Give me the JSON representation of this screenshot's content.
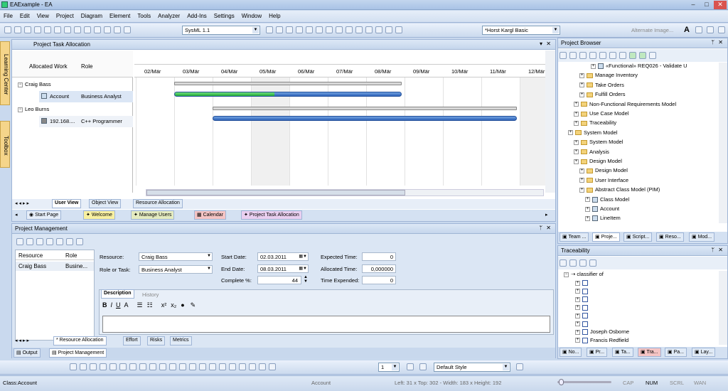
{
  "window": {
    "title": "EAExample - EA"
  },
  "menu": [
    "File",
    "Edit",
    "View",
    "Project",
    "Diagram",
    "Element",
    "Tools",
    "Analyzer",
    "Add-Ins",
    "Settings",
    "Window",
    "Help"
  ],
  "toolbar": {
    "technology": "SysML 1.1",
    "perspective": "*Horst Kargl Basic",
    "alternate_image": "Alternate Image..."
  },
  "side_tabs": [
    "Learning Center",
    "Toolbox"
  ],
  "task_allocation": {
    "title": "Project Task Allocation",
    "col_work": "Allocated Work",
    "col_role": "Role",
    "dates": [
      "02/Mär",
      "03/Mär",
      "04/Mär",
      "05/Mär",
      "06/Mär",
      "07/Mär",
      "08/Mär",
      "09/Mär",
      "10/Mär",
      "11/Mär",
      "12/Mär"
    ],
    "rows": [
      {
        "name": "Craig Bass",
        "type": "resource"
      },
      {
        "name": "Account",
        "role": "Business Analyst",
        "type": "task"
      },
      {
        "name": "Leo Burns",
        "type": "resource"
      },
      {
        "name": "192.168....",
        "role": "C++ Programmer",
        "type": "task"
      }
    ],
    "progress": [
      {
        "start": "03/Mär",
        "end": "08/Mär",
        "complete_fraction": 0.44
      },
      {
        "start": "04/Mär",
        "end": "11/Mär",
        "complete_fraction": 0
      }
    ],
    "view_tabs": [
      "User View",
      "Object View",
      "Resource Allocation"
    ]
  },
  "doc_tabs": [
    "Start Page",
    "Welcome",
    "Manage Users",
    "Calendar",
    "Project Task Allocation"
  ],
  "project_management": {
    "title": "Project Management",
    "list_headers": [
      "Resource",
      "Role"
    ],
    "list_row": {
      "resource": "Craig Bass",
      "role": "Busine..."
    },
    "resource_label": "Resource:",
    "resource_value": "Craig Bass",
    "role_label": "Role or Task:",
    "role_value": "Business Analyst",
    "start_label": "Start Date:",
    "start_value": "02.03.2011",
    "end_label": "End Date:",
    "end_value": "08.03.2011",
    "complete_label": "Complete %:",
    "complete_value": "44",
    "expected_label": "Expected Time:",
    "expected_value": "0",
    "allocated_label": "Allocated Time:",
    "allocated_value": "0,000000",
    "expended_label": "Time Expended:",
    "expended_value": "0",
    "desc_tab": "Description",
    "history_tab": "History",
    "bottom_tabs": [
      "* Resource Allocation",
      "Effort",
      "Risks",
      "Metrics"
    ],
    "output_tabs": [
      "Output",
      "Project Management"
    ]
  },
  "project_browser": {
    "title": "Project Browser",
    "items": [
      {
        "label": "«Functional» REQ026 - Validate U",
        "indent": 6,
        "kind": "elem"
      },
      {
        "label": "Manage Inventory",
        "indent": 4,
        "kind": "folder"
      },
      {
        "label": "Take Orders",
        "indent": 4,
        "kind": "folder"
      },
      {
        "label": "Fulfill Orders",
        "indent": 4,
        "kind": "folder"
      },
      {
        "label": "Non-Functional Requirements Model",
        "indent": 3,
        "kind": "folder"
      },
      {
        "label": "Use Case Model",
        "indent": 3,
        "kind": "folder"
      },
      {
        "label": "Traceability",
        "indent": 3,
        "kind": "folder"
      },
      {
        "label": "System Model",
        "indent": 2,
        "kind": "folder"
      },
      {
        "label": "System Model",
        "indent": 3,
        "kind": "folder"
      },
      {
        "label": "Analysis",
        "indent": 3,
        "kind": "folder"
      },
      {
        "label": "Design Model",
        "indent": 3,
        "kind": "folder"
      },
      {
        "label": "Design Model",
        "indent": 4,
        "kind": "folder"
      },
      {
        "label": "User Interface",
        "indent": 4,
        "kind": "folder"
      },
      {
        "label": "Abstract Class Model (PIM)",
        "indent": 4,
        "kind": "folder"
      },
      {
        "label": "Class Model",
        "indent": 5,
        "kind": "elem"
      },
      {
        "label": "Account",
        "indent": 5,
        "kind": "elem"
      },
      {
        "label": "LineItem",
        "indent": 5,
        "kind": "elem"
      }
    ],
    "tabs": [
      "Team ...",
      "Proje...",
      "Script...",
      "Reso...",
      "Mod..."
    ]
  },
  "traceability": {
    "title": "Traceability",
    "root": "classifier of",
    "people": [
      "Joseph Osborne",
      "Francis Redfield"
    ],
    "tabs": [
      "No...",
      "Pr...",
      "Ta...",
      "Tra...",
      "Pa...",
      "Lay..."
    ]
  },
  "bottom_toolbar": {
    "style": "Default Style",
    "line_width": "1"
  },
  "status": {
    "left": "Class:Account",
    "element": "Account",
    "position": "Left:  31 x Top:  302 - Width:  183 x Height:  192",
    "indicators": [
      "CAP",
      "NUM",
      "SCRL",
      "WAN"
    ]
  }
}
